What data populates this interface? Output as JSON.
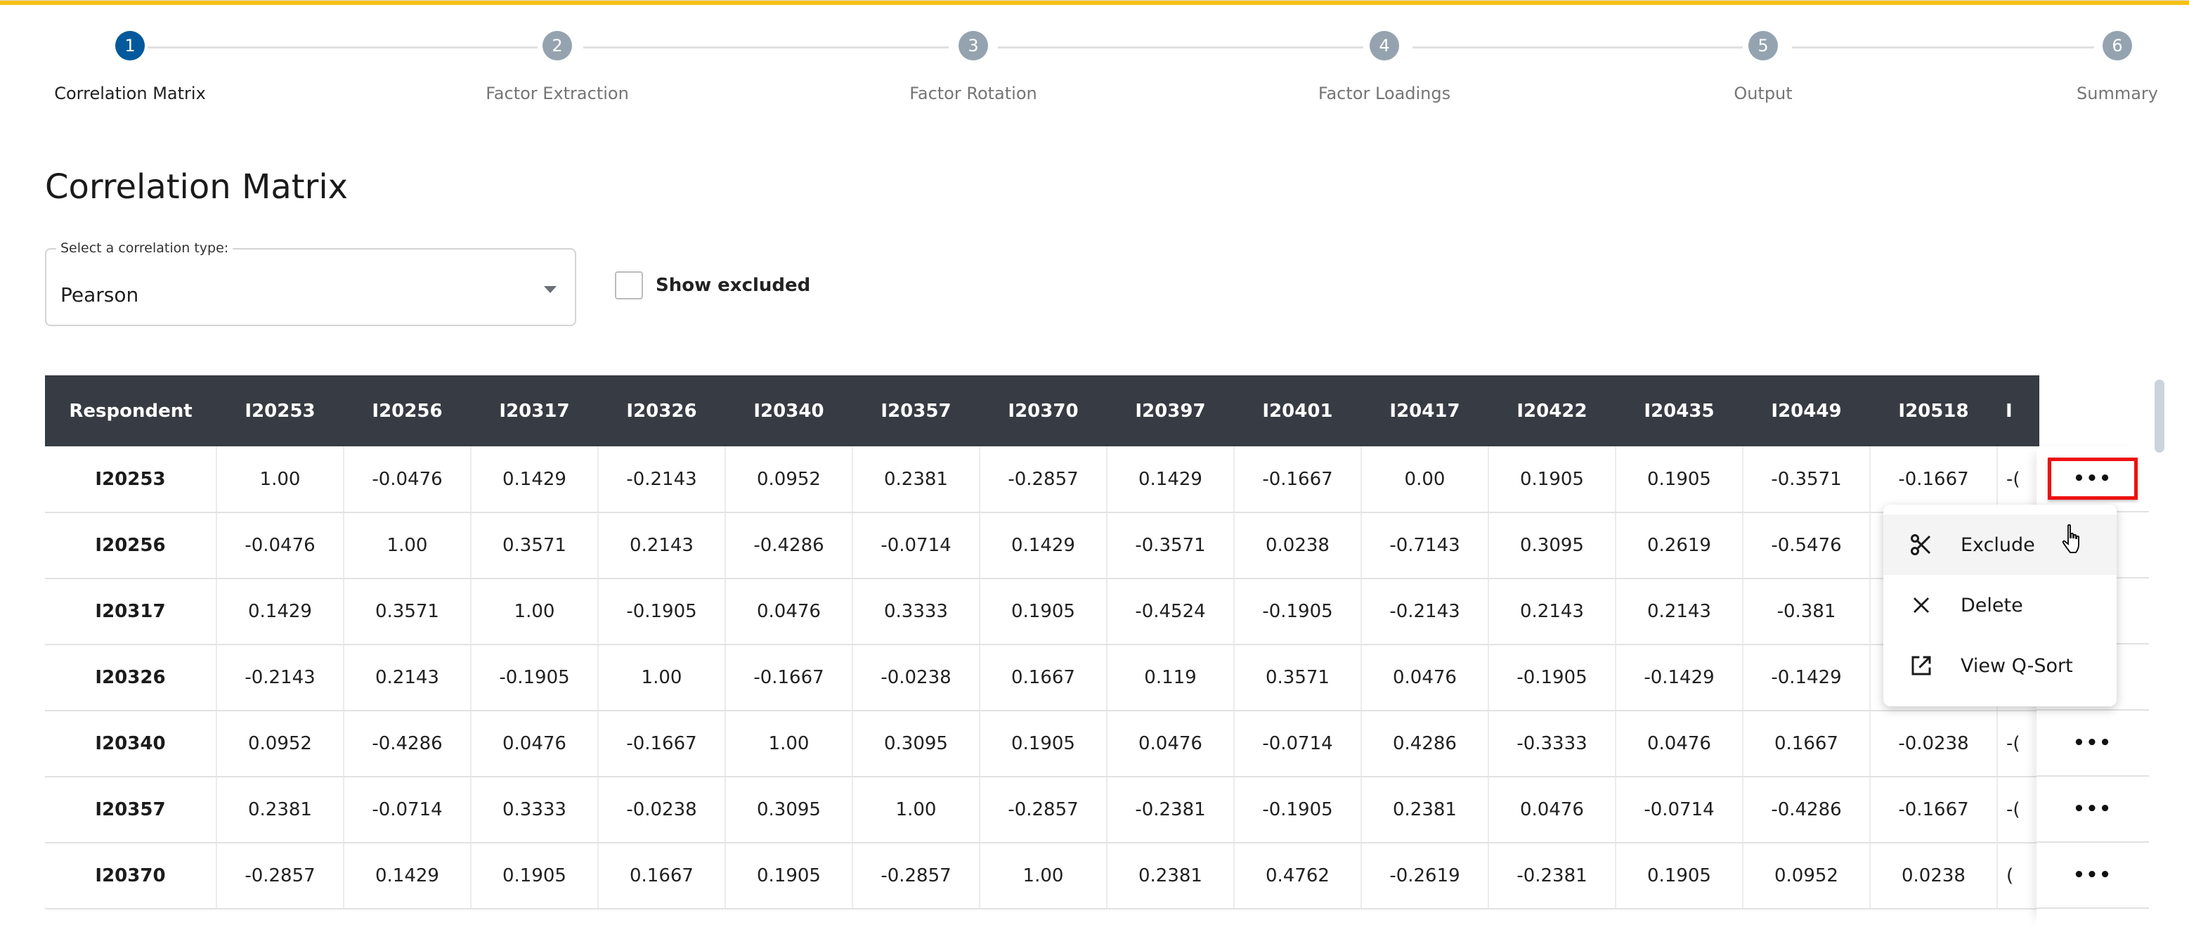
{
  "stepper": {
    "steps": [
      {
        "number": "1",
        "label": "Correlation Matrix",
        "active": true
      },
      {
        "number": "2",
        "label": "Factor Extraction",
        "active": false
      },
      {
        "number": "3",
        "label": "Factor Rotation",
        "active": false
      },
      {
        "number": "4",
        "label": "Factor Loadings",
        "active": false
      },
      {
        "number": "5",
        "label": "Output",
        "active": false
      },
      {
        "number": "6",
        "label": "Summary",
        "active": false
      }
    ]
  },
  "page": {
    "title": "Correlation Matrix"
  },
  "controls": {
    "correlation_type_label": "Select a correlation type:",
    "correlation_type_value": "Pearson",
    "show_excluded_label": "Show excluded",
    "show_excluded_checked": false
  },
  "table": {
    "header_first": "Respondent",
    "columns": [
      "I20253",
      "I20256",
      "I20317",
      "I20326",
      "I20340",
      "I20357",
      "I20370",
      "I20397",
      "I20401",
      "I20417",
      "I20422",
      "I20435",
      "I20449",
      "I20518"
    ],
    "partial_column_header": "I",
    "rows": [
      {
        "respondent": "I20253",
        "values": [
          "1.00",
          "-0.0476",
          "0.1429",
          "-0.2143",
          "0.0952",
          "0.2381",
          "-0.2857",
          "0.1429",
          "-0.1667",
          "0.00",
          "0.1905",
          "0.1905",
          "-0.3571",
          "-0.1667"
        ],
        "partial": "-("
      },
      {
        "respondent": "I20256",
        "values": [
          "-0.0476",
          "1.00",
          "0.3571",
          "0.2143",
          "-0.4286",
          "-0.0714",
          "0.1429",
          "-0.3571",
          "0.0238",
          "-0.7143",
          "0.3095",
          "0.2619",
          "-0.5476",
          ""
        ],
        "partial": ""
      },
      {
        "respondent": "I20317",
        "values": [
          "0.1429",
          "0.3571",
          "1.00",
          "-0.1905",
          "0.0476",
          "0.3333",
          "0.1905",
          "-0.4524",
          "-0.1905",
          "-0.2143",
          "0.2143",
          "0.2143",
          "-0.381",
          ""
        ],
        "partial": ""
      },
      {
        "respondent": "I20326",
        "values": [
          "-0.2143",
          "0.2143",
          "-0.1905",
          "1.00",
          "-0.1667",
          "-0.0238",
          "0.1667",
          "0.119",
          "0.3571",
          "0.0476",
          "-0.1905",
          "-0.1429",
          "-0.1429",
          ""
        ],
        "partial": ""
      },
      {
        "respondent": "I20340",
        "values": [
          "0.0952",
          "-0.4286",
          "0.0476",
          "-0.1667",
          "1.00",
          "0.3095",
          "0.1905",
          "0.0476",
          "-0.0714",
          "0.4286",
          "-0.3333",
          "0.0476",
          "0.1667",
          "-0.0238"
        ],
        "partial": "-("
      },
      {
        "respondent": "I20357",
        "values": [
          "0.2381",
          "-0.0714",
          "0.3333",
          "-0.0238",
          "0.3095",
          "1.00",
          "-0.2857",
          "-0.2381",
          "-0.1905",
          "0.2381",
          "0.0476",
          "-0.0714",
          "-0.4286",
          "-0.1667"
        ],
        "partial": "-("
      },
      {
        "respondent": "I20370",
        "values": [
          "-0.2857",
          "0.1429",
          "0.1905",
          "0.1667",
          "0.1905",
          "-0.2857",
          "1.00",
          "0.2381",
          "0.4762",
          "-0.2619",
          "-0.2381",
          "0.1905",
          "0.0952",
          "0.0238"
        ],
        "partial": "("
      }
    ],
    "row_action_label": "•••"
  },
  "context_menu": {
    "items": [
      {
        "label": "Exclude",
        "icon": "scissors-icon",
        "hovered": true
      },
      {
        "label": "Delete",
        "icon": "close-icon",
        "hovered": false
      },
      {
        "label": "View Q-Sort",
        "icon": "open-in-new-icon",
        "hovered": false
      }
    ]
  }
}
